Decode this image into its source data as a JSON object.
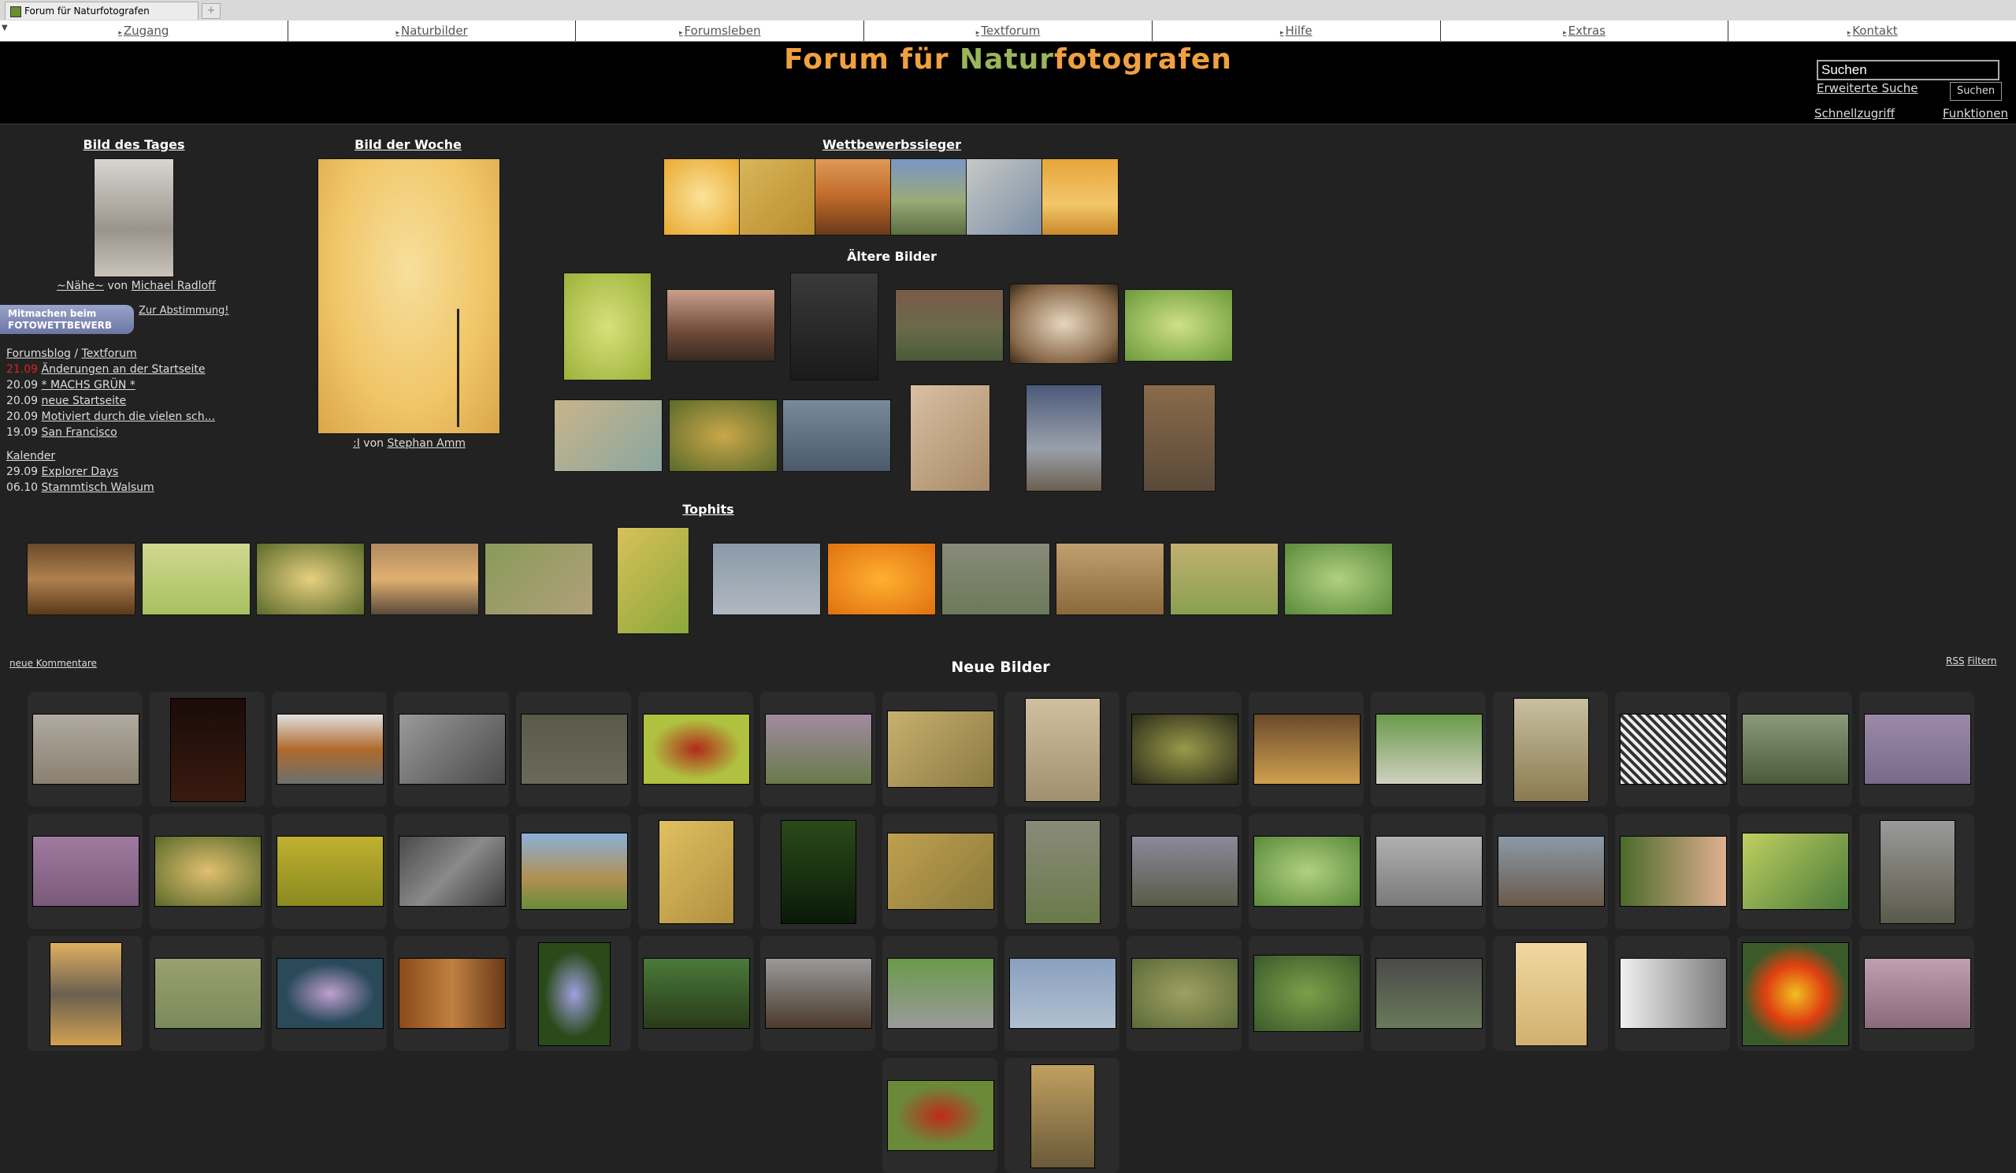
{
  "window": {
    "tab_title": "Forum für Naturfotografen",
    "new_tab": "+"
  },
  "nav": [
    "Zugang",
    "Naturbilder",
    "Forumsleben",
    "Textforum",
    "Hilfe",
    "Extras",
    "Kontakt"
  ],
  "header": {
    "title_part1": "Forum für ",
    "title_part2": "Natur",
    "title_part3": "fotografen",
    "search_placeholder": "Suchen",
    "advanced_search": "Erweiterte Suche",
    "search_button": "Suchen",
    "quick_access": "Schnellzugriff",
    "functions": "Funktionen"
  },
  "bild_des_tages": {
    "heading": "Bild des Tages",
    "title": "~Nähe~",
    "by": " von ",
    "author": "Michael Radloff"
  },
  "contest": {
    "button_line1": "Mitmachen beim",
    "button_line2": "FOTOWETTBEWERB",
    "vote_link": "Zur Abstimmung!"
  },
  "blog": {
    "link1": "Forumsblog",
    "sep": " / ",
    "link2": "Textforum",
    "entries": [
      {
        "date": "21.09",
        "text": "Änderungen an der Startseite",
        "highlight": true
      },
      {
        "date": "20.09",
        "text": "* MACHS GRÜN *",
        "highlight": false
      },
      {
        "date": "20.09",
        "text": "neue Startseite",
        "highlight": false
      },
      {
        "date": "20.09",
        "text": "Motiviert durch die vielen sch...",
        "highlight": false
      },
      {
        "date": "19.09",
        "text": "San Francisco",
        "highlight": false
      }
    ]
  },
  "calendar": {
    "heading": "Kalender",
    "entries": [
      {
        "date": "29.09",
        "text": "Explorer Days"
      },
      {
        "date": "06.10",
        "text": "Stammtisch Walsum"
      }
    ]
  },
  "bild_der_woche": {
    "heading": "Bild der Woche",
    "title": ":I",
    "by": " von ",
    "author": "Stephan Amm"
  },
  "wettbewerb": {
    "heading": "Wettbewerbssieger"
  },
  "aeltere": {
    "heading": "Ältere Bilder"
  },
  "tophits": {
    "heading": "Tophits"
  },
  "neue": {
    "heading": "Neue Bilder",
    "comments_link": "neue Kommentare",
    "rss": "RSS",
    "filter": "Filtern"
  },
  "colors": {
    "background": "#222222",
    "header_bg": "#000000",
    "title_orange": "#f0a040",
    "title_green": "#9ab55a",
    "highlight_red": "#e02020",
    "cell_bg": "#2b2b2b"
  }
}
